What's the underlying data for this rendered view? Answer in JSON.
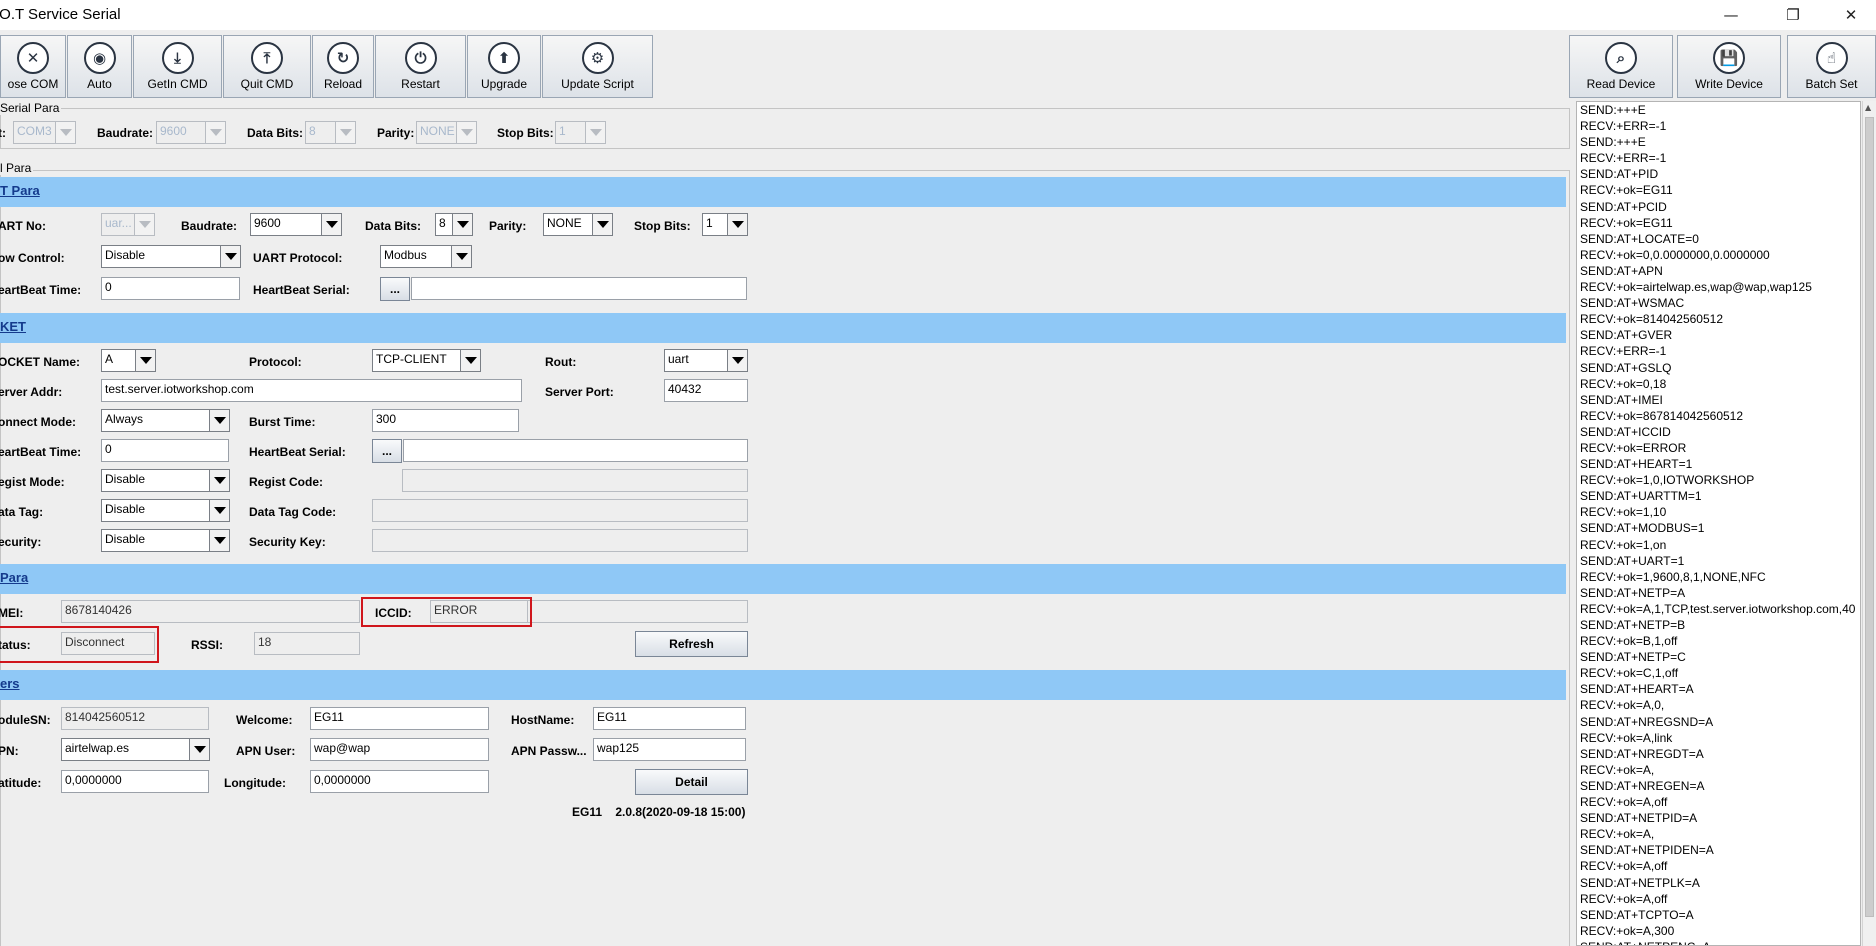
{
  "window": {
    "title": ".O.T Service Serial",
    "minimize": "—",
    "maximize": "❐",
    "close": "✕"
  },
  "toolbar": [
    {
      "label": "ose COM",
      "icon": "✕"
    },
    {
      "label": "Auto",
      "icon": "◉"
    },
    {
      "label": "GetIn CMD",
      "icon": "⤓"
    },
    {
      "label": "Quit CMD",
      "icon": "⤒"
    },
    {
      "label": "Reload",
      "icon": "↻"
    },
    {
      "label": "Restart",
      "icon": "⏻"
    },
    {
      "label": "Upgrade",
      "icon": "⬆"
    },
    {
      "label": "Update Script",
      "icon": "⚙"
    }
  ],
  "toolbar_right": [
    {
      "label": "Read Device",
      "icon": "⌕"
    },
    {
      "label": "Write Device",
      "icon": "💾"
    },
    {
      "label": "Batch Set",
      "icon": "☝"
    }
  ],
  "serial_para": {
    "title": "Serial Para",
    "port_label": "t:",
    "port_value": "COM3",
    "baud_label": "Baudrate:",
    "baud_value": "9600",
    "databits_label": "Data Bits:",
    "databits_value": "8",
    "parity_label": "Parity:",
    "parity_value": "NONE",
    "stopbits_label": "Stop Bits:",
    "stopbits_value": "1"
  },
  "device_para_title": "l Para",
  "uart": {
    "title": "T Para",
    "uartno_label": "ART No:",
    "uartno_value": "uar...",
    "baud_label": "Baudrate:",
    "baud_value": "9600",
    "databits_label": "Data Bits:",
    "databits_value": "8",
    "parity_label": "Parity:",
    "parity_value": "NONE",
    "stopbits_label": "Stop Bits:",
    "stopbits_value": "1",
    "flow_label": "ow Control:",
    "flow_value": "Disable",
    "protocol_label": "UART Protocol:",
    "protocol_value": "Modbus",
    "hb_time_label": "eartBeat Time:",
    "hb_time_value": "0",
    "hb_serial_label": "HeartBeat Serial:",
    "hb_serial_btn": "...",
    "hb_serial_value": ""
  },
  "socket": {
    "title": "KET",
    "name_label": "OCKET Name:",
    "name_value": "A",
    "protocol_label": "Protocol:",
    "protocol_value": "TCP-CLIENT",
    "rout_label": "Rout:",
    "rout_value": "uart",
    "addr_label": "erver Addr:",
    "addr_value": "test.server.iotworkshop.com",
    "port_label": "Server Port:",
    "port_value": "40432",
    "conn_label": "onnect Mode:",
    "conn_value": "Always",
    "burst_label": "Burst Time:",
    "burst_value": "300",
    "hb_time_label": "eartBeat Time:",
    "hb_time_value": "0",
    "hb_serial_label": "HeartBeat Serial:",
    "hb_serial_btn": "...",
    "hb_serial_value": "",
    "regist_label": "egist Mode:",
    "regist_value": "Disable",
    "regist_code_label": "Regist Code:",
    "regist_code_value": "",
    "datatag_label": "ata Tag:",
    "datatag_value": "Disable",
    "datatag_code_label": "Data Tag Code:",
    "datatag_code_value": "",
    "security_label": "ecurity:",
    "security_value": "Disable",
    "seckey_label": "Security Key:",
    "seckey_value": ""
  },
  "nb": {
    "title": "Para",
    "imei_label": "MEI:",
    "imei_value": "8678140426",
    "iccid_label": "ICCID:",
    "iccid_value": "ERROR",
    "status_label": "tatus:",
    "status_value": "Disconnect",
    "rssi_label": "RSSI:",
    "rssi_value": "18",
    "refresh": "Refresh"
  },
  "others": {
    "title": "ers",
    "sn_label": "oduleSN:",
    "sn_value": "814042560512",
    "welcome_label": "Welcome:",
    "welcome_value": "EG11",
    "host_label": "HostName:",
    "host_value": "EG11",
    "apn_label": "PN:",
    "apn_value": "airtelwap.es",
    "apnuser_label": "APN User:",
    "apnuser_value": "wap@wap",
    "apnpass_label": "APN Passw...",
    "apnpass_value": "wap125",
    "lat_label": "atitude:",
    "lat_value": "0,0000000",
    "lon_label": "Longitude:",
    "lon_value": "0,0000000",
    "detail": "Detail",
    "version": "EG11    2.0.8(2020-09-18 15:00)"
  },
  "log": [
    "SEND:+++E",
    "RECV:+ERR=-1",
    "SEND:+++E",
    "RECV:+ERR=-1",
    "SEND:AT+PID",
    "RECV:+ok=EG11",
    "SEND:AT+PCID",
    "RECV:+ok=EG11",
    "SEND:AT+LOCATE=0",
    "RECV:+ok=0,0.0000000,0.0000000",
    "SEND:AT+APN",
    "RECV:+ok=airtelwap.es,wap@wap,wap125",
    "SEND:AT+WSMAC",
    "RECV:+ok=814042560512",
    "SEND:AT+GVER",
    "RECV:+ERR=-1",
    "SEND:AT+GSLQ",
    "RECV:+ok=0,18",
    "SEND:AT+IMEI",
    "RECV:+ok=867814042560512",
    "SEND:AT+ICCID",
    "RECV:+ok=ERROR",
    "SEND:AT+HEART=1",
    "RECV:+ok=1,0,IOTWORKSHOP",
    "SEND:AT+UARTTM=1",
    "RECV:+ok=1,10",
    "SEND:AT+MODBUS=1",
    "RECV:+ok=1,on",
    "SEND:AT+UART=1",
    "RECV:+ok=1,9600,8,1,NONE,NFC",
    "SEND:AT+NETP=A",
    "RECV:+ok=A,1,TCP,test.server.iotworkshop.com,40",
    "SEND:AT+NETP=B",
    "RECV:+ok=B,1,off",
    "SEND:AT+NETP=C",
    "RECV:+ok=C,1,off",
    "SEND:AT+HEART=A",
    "RECV:+ok=A,0,",
    "SEND:AT+NREGSND=A",
    "RECV:+ok=A,link",
    "SEND:AT+NREGDT=A",
    "RECV:+ok=A,",
    "SEND:AT+NREGEN=A",
    "RECV:+ok=A,off",
    "SEND:AT+NETPID=A",
    "RECV:+ok=A,",
    "SEND:AT+NETPIDEN=A",
    "RECV:+ok=A,off",
    "SEND:AT+NETPLK=A",
    "RECV:+ok=A,off",
    "SEND:AT+TCPTO=A",
    "RECV:+ok=A,300",
    "SEND:AT+NETPENC=A"
  ]
}
